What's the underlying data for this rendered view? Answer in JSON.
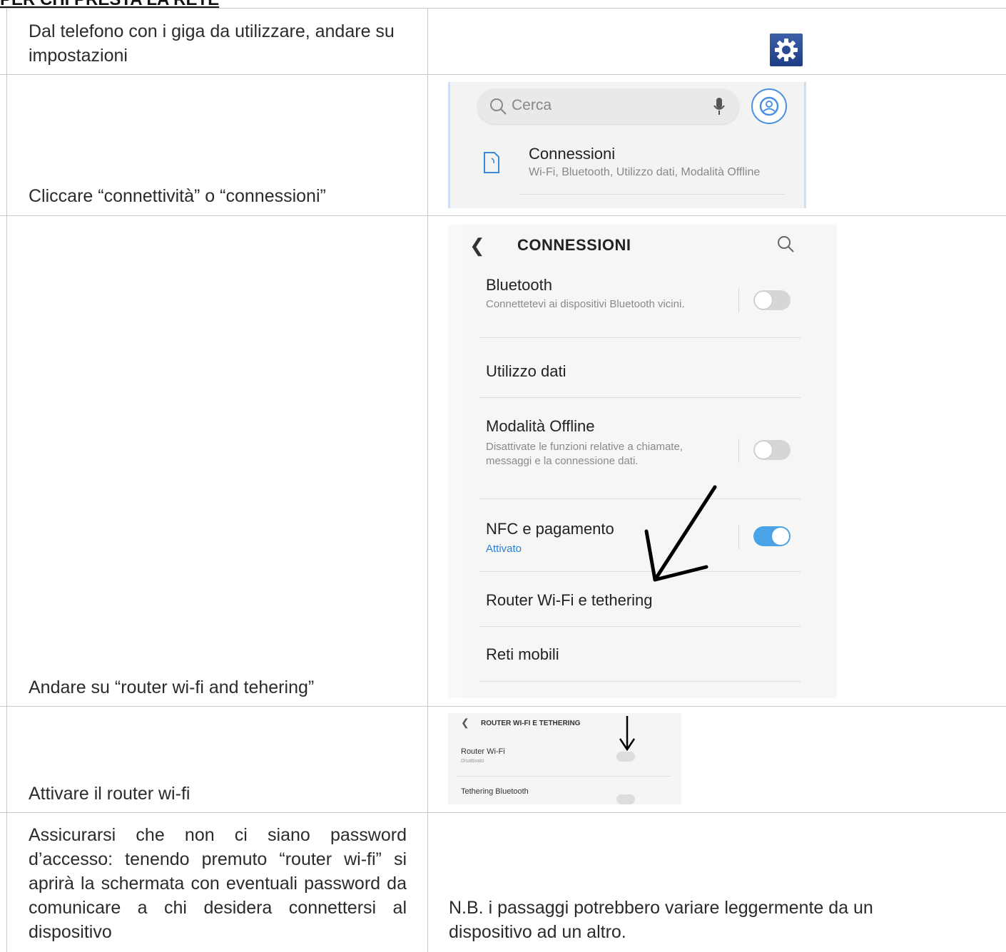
{
  "header": "PER CHI PRESTA LA RETE",
  "steps": [
    {
      "text": "Dal telefono con i giga da utilizzare, andare su impostazioni"
    },
    {
      "text": "Cliccare “connettività” o “connessioni”"
    },
    {
      "text": "Andare su “router wi-fi and tehering”"
    },
    {
      "text": "Attivare il router wi-fi"
    },
    {
      "text": "Assicurarsi che non ci siano password d’accesso: tenendo premuto “router wi-fi” si aprirà la schermata con eventuali password da comunicare a chi desidera connettersi al dispositivo"
    }
  ],
  "note": "N.B. i passaggi potrebbero variare leggermente da un dispositivo ad un altro.",
  "settings_screen": {
    "search_placeholder": "Cerca",
    "connections_title": "Connessioni",
    "connections_sub": "Wi-Fi, Bluetooth, Utilizzo dati, Modalità Offline"
  },
  "connections_screen": {
    "title": "CONNESSIONI",
    "items": [
      {
        "title": "Bluetooth",
        "sub": "Connettetevi ai dispositivi Bluetooth vicini.",
        "toggle": false
      },
      {
        "title": "Utilizzo dati"
      },
      {
        "title": "Modalità Offline",
        "sub": "Disattivate le funzioni relative a chiamate, messaggi e la connessione dati.",
        "toggle": false
      },
      {
        "title": "NFC e pagamento",
        "sub": "Attivato",
        "toggle": true
      },
      {
        "title": "Router Wi-Fi e tethering"
      },
      {
        "title": "Reti mobili"
      }
    ]
  },
  "router_screen": {
    "title": "ROUTER WI-FI E TETHERING",
    "items": [
      {
        "title": "Router Wi-Fi",
        "sub": "Disattivato"
      },
      {
        "title": "Tethering Bluetooth"
      }
    ]
  },
  "colors": {
    "accent": "#4aa3e6",
    "gear_bg": "#2a4a96"
  }
}
